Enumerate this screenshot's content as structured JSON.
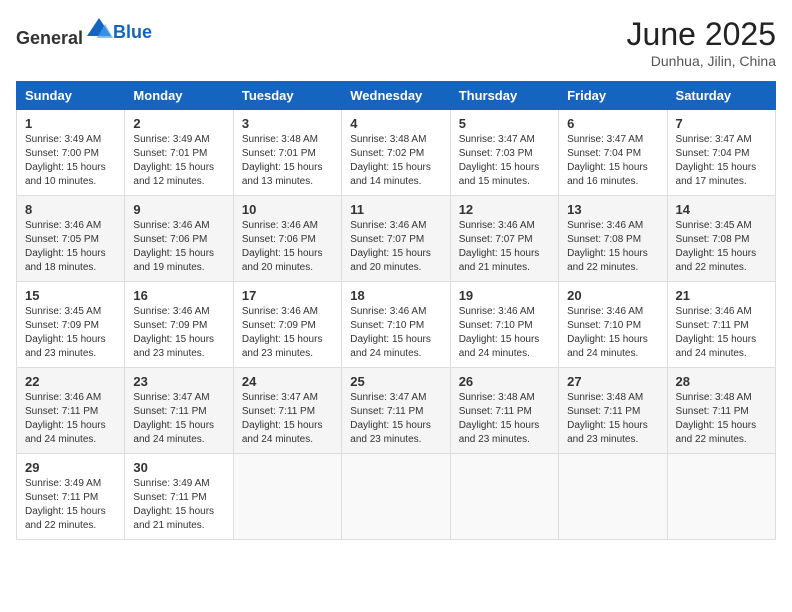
{
  "header": {
    "logo_general": "General",
    "logo_blue": "Blue",
    "title": "June 2025",
    "location": "Dunhua, Jilin, China"
  },
  "weekdays": [
    "Sunday",
    "Monday",
    "Tuesday",
    "Wednesday",
    "Thursday",
    "Friday",
    "Saturday"
  ],
  "weeks": [
    [
      {
        "day": "1",
        "sunrise": "Sunrise: 3:49 AM",
        "sunset": "Sunset: 7:00 PM",
        "daylight": "Daylight: 15 hours and 10 minutes."
      },
      {
        "day": "2",
        "sunrise": "Sunrise: 3:49 AM",
        "sunset": "Sunset: 7:01 PM",
        "daylight": "Daylight: 15 hours and 12 minutes."
      },
      {
        "day": "3",
        "sunrise": "Sunrise: 3:48 AM",
        "sunset": "Sunset: 7:01 PM",
        "daylight": "Daylight: 15 hours and 13 minutes."
      },
      {
        "day": "4",
        "sunrise": "Sunrise: 3:48 AM",
        "sunset": "Sunset: 7:02 PM",
        "daylight": "Daylight: 15 hours and 14 minutes."
      },
      {
        "day": "5",
        "sunrise": "Sunrise: 3:47 AM",
        "sunset": "Sunset: 7:03 PM",
        "daylight": "Daylight: 15 hours and 15 minutes."
      },
      {
        "day": "6",
        "sunrise": "Sunrise: 3:47 AM",
        "sunset": "Sunset: 7:04 PM",
        "daylight": "Daylight: 15 hours and 16 minutes."
      },
      {
        "day": "7",
        "sunrise": "Sunrise: 3:47 AM",
        "sunset": "Sunset: 7:04 PM",
        "daylight": "Daylight: 15 hours and 17 minutes."
      }
    ],
    [
      {
        "day": "8",
        "sunrise": "Sunrise: 3:46 AM",
        "sunset": "Sunset: 7:05 PM",
        "daylight": "Daylight: 15 hours and 18 minutes."
      },
      {
        "day": "9",
        "sunrise": "Sunrise: 3:46 AM",
        "sunset": "Sunset: 7:06 PM",
        "daylight": "Daylight: 15 hours and 19 minutes."
      },
      {
        "day": "10",
        "sunrise": "Sunrise: 3:46 AM",
        "sunset": "Sunset: 7:06 PM",
        "daylight": "Daylight: 15 hours and 20 minutes."
      },
      {
        "day": "11",
        "sunrise": "Sunrise: 3:46 AM",
        "sunset": "Sunset: 7:07 PM",
        "daylight": "Daylight: 15 hours and 20 minutes."
      },
      {
        "day": "12",
        "sunrise": "Sunrise: 3:46 AM",
        "sunset": "Sunset: 7:07 PM",
        "daylight": "Daylight: 15 hours and 21 minutes."
      },
      {
        "day": "13",
        "sunrise": "Sunrise: 3:46 AM",
        "sunset": "Sunset: 7:08 PM",
        "daylight": "Daylight: 15 hours and 22 minutes."
      },
      {
        "day": "14",
        "sunrise": "Sunrise: 3:45 AM",
        "sunset": "Sunset: 7:08 PM",
        "daylight": "Daylight: 15 hours and 22 minutes."
      }
    ],
    [
      {
        "day": "15",
        "sunrise": "Sunrise: 3:45 AM",
        "sunset": "Sunset: 7:09 PM",
        "daylight": "Daylight: 15 hours and 23 minutes."
      },
      {
        "day": "16",
        "sunrise": "Sunrise: 3:46 AM",
        "sunset": "Sunset: 7:09 PM",
        "daylight": "Daylight: 15 hours and 23 minutes."
      },
      {
        "day": "17",
        "sunrise": "Sunrise: 3:46 AM",
        "sunset": "Sunset: 7:09 PM",
        "daylight": "Daylight: 15 hours and 23 minutes."
      },
      {
        "day": "18",
        "sunrise": "Sunrise: 3:46 AM",
        "sunset": "Sunset: 7:10 PM",
        "daylight": "Daylight: 15 hours and 24 minutes."
      },
      {
        "day": "19",
        "sunrise": "Sunrise: 3:46 AM",
        "sunset": "Sunset: 7:10 PM",
        "daylight": "Daylight: 15 hours and 24 minutes."
      },
      {
        "day": "20",
        "sunrise": "Sunrise: 3:46 AM",
        "sunset": "Sunset: 7:10 PM",
        "daylight": "Daylight: 15 hours and 24 minutes."
      },
      {
        "day": "21",
        "sunrise": "Sunrise: 3:46 AM",
        "sunset": "Sunset: 7:11 PM",
        "daylight": "Daylight: 15 hours and 24 minutes."
      }
    ],
    [
      {
        "day": "22",
        "sunrise": "Sunrise: 3:46 AM",
        "sunset": "Sunset: 7:11 PM",
        "daylight": "Daylight: 15 hours and 24 minutes."
      },
      {
        "day": "23",
        "sunrise": "Sunrise: 3:47 AM",
        "sunset": "Sunset: 7:11 PM",
        "daylight": "Daylight: 15 hours and 24 minutes."
      },
      {
        "day": "24",
        "sunrise": "Sunrise: 3:47 AM",
        "sunset": "Sunset: 7:11 PM",
        "daylight": "Daylight: 15 hours and 24 minutes."
      },
      {
        "day": "25",
        "sunrise": "Sunrise: 3:47 AM",
        "sunset": "Sunset: 7:11 PM",
        "daylight": "Daylight: 15 hours and 23 minutes."
      },
      {
        "day": "26",
        "sunrise": "Sunrise: 3:48 AM",
        "sunset": "Sunset: 7:11 PM",
        "daylight": "Daylight: 15 hours and 23 minutes."
      },
      {
        "day": "27",
        "sunrise": "Sunrise: 3:48 AM",
        "sunset": "Sunset: 7:11 PM",
        "daylight": "Daylight: 15 hours and 23 minutes."
      },
      {
        "day": "28",
        "sunrise": "Sunrise: 3:48 AM",
        "sunset": "Sunset: 7:11 PM",
        "daylight": "Daylight: 15 hours and 22 minutes."
      }
    ],
    [
      {
        "day": "29",
        "sunrise": "Sunrise: 3:49 AM",
        "sunset": "Sunset: 7:11 PM",
        "daylight": "Daylight: 15 hours and 22 minutes."
      },
      {
        "day": "30",
        "sunrise": "Sunrise: 3:49 AM",
        "sunset": "Sunset: 7:11 PM",
        "daylight": "Daylight: 15 hours and 21 minutes."
      },
      null,
      null,
      null,
      null,
      null
    ]
  ]
}
